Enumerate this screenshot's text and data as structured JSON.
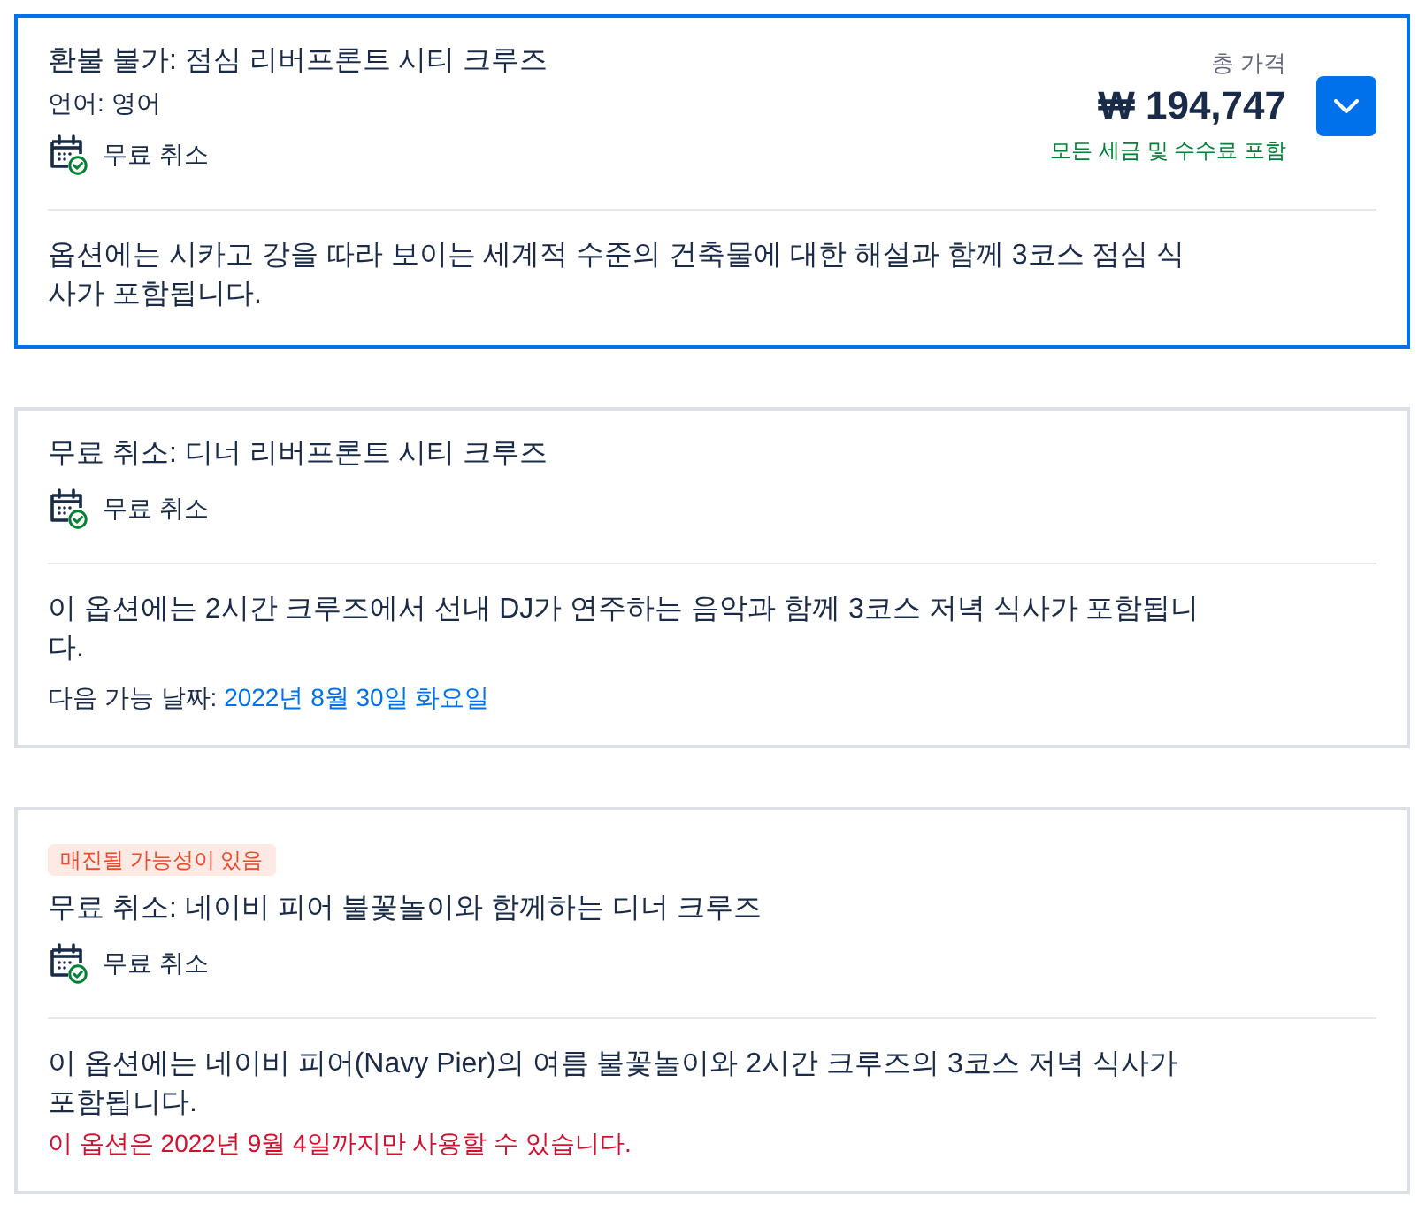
{
  "options": [
    {
      "selected": true,
      "title": "환불 불가: 점심 리버프론트 시티 크루즈",
      "language": "언어: 영어",
      "cancellation": "무료 취소",
      "price": {
        "label": "총 가격",
        "amount": "₩ 194,747",
        "note": "모든 세금 및 수수료 포함"
      },
      "expand_button": {
        "expanded": false
      },
      "description": "옵션에는 시카고 강을 따라 보이는 세계적 수준의 건축물에 대한 해설과 함께 3코스 점심 식사가 포함됩니다."
    },
    {
      "selected": false,
      "title": "무료 취소: 디너 리버프론트 시티 크루즈",
      "cancellation": "무료 취소",
      "description": "이 옵션에는 2시간 크루즈에서 선내 DJ가 연주하는 음악과 함께 3코스 저녁 식사가 포함됩니다.",
      "availability": {
        "kind": "next_date",
        "label": "다음 가능 날짜:",
        "value": "2022년 8월 30일 화요일"
      }
    },
    {
      "selected": false,
      "badge": "매진될 가능성이 있음",
      "title": "무료 취소: 네이비 피어 불꽃놀이와 함께하는 디너 크루즈",
      "cancellation": "무료 취소",
      "description": "이 옵션에는 네이비 피어(Navy Pier)의 여름 불꽃놀이와 2시간 크루즈의 3코스 저녁 식사가 포함됩니다.",
      "availability": {
        "kind": "deadline",
        "text": "이 옵션은 2022년 9월 4일까지만 사용할 수 있습니다."
      }
    }
  ]
}
